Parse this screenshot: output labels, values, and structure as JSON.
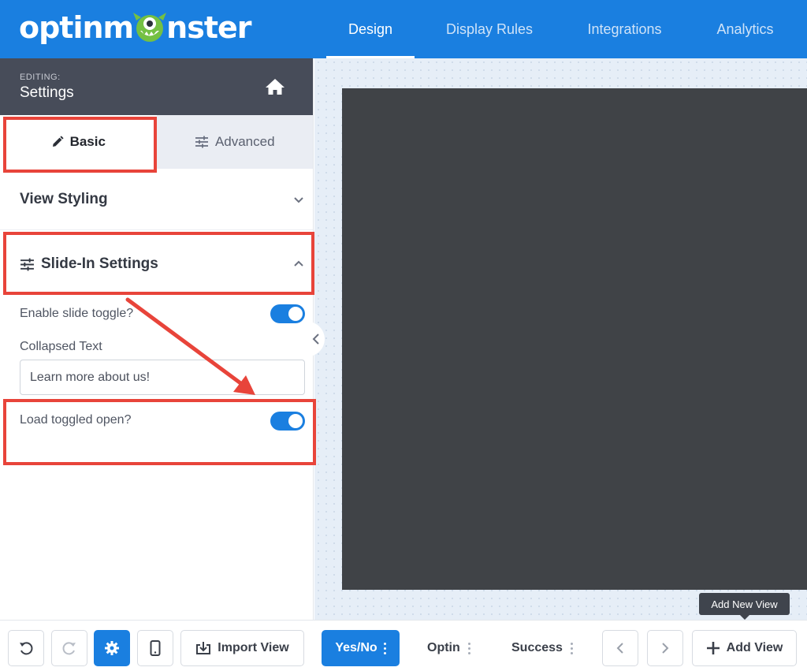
{
  "app": {
    "logo_left": "optinm",
    "logo_right": "nster"
  },
  "nav": {
    "tabs": [
      {
        "label": "Design",
        "active": true
      },
      {
        "label": "Display Rules",
        "active": false
      },
      {
        "label": "Integrations",
        "active": false
      },
      {
        "label": "Analytics",
        "active": false
      }
    ]
  },
  "editing": {
    "kicker": "EDITING:",
    "title": "Settings",
    "home_icon": "home-icon"
  },
  "subtabs": {
    "basic": "Basic",
    "advanced": "Advanced"
  },
  "sections": {
    "view_styling": "View Styling",
    "slide_in": "Slide-In Settings"
  },
  "slide_in_settings": {
    "enable_toggle_label": "Enable slide toggle?",
    "enable_toggle_on": true,
    "collapsed_text_label": "Collapsed Text",
    "collapsed_text_value": "Learn more about us!",
    "load_open_label": "Load toggled open?",
    "load_open_on": true
  },
  "bottom": {
    "import_view": "Import View",
    "views": [
      {
        "label": "Yes/No",
        "active": true
      },
      {
        "label": "Optin",
        "active": false
      },
      {
        "label": "Success",
        "active": false
      }
    ],
    "add_view": "Add View",
    "tooltip": "Add New View"
  },
  "colors": {
    "brand_blue": "#1a7fe0",
    "header_dark": "#474c59",
    "annotation_red": "#e8443a",
    "preview_dark": "#404347"
  }
}
